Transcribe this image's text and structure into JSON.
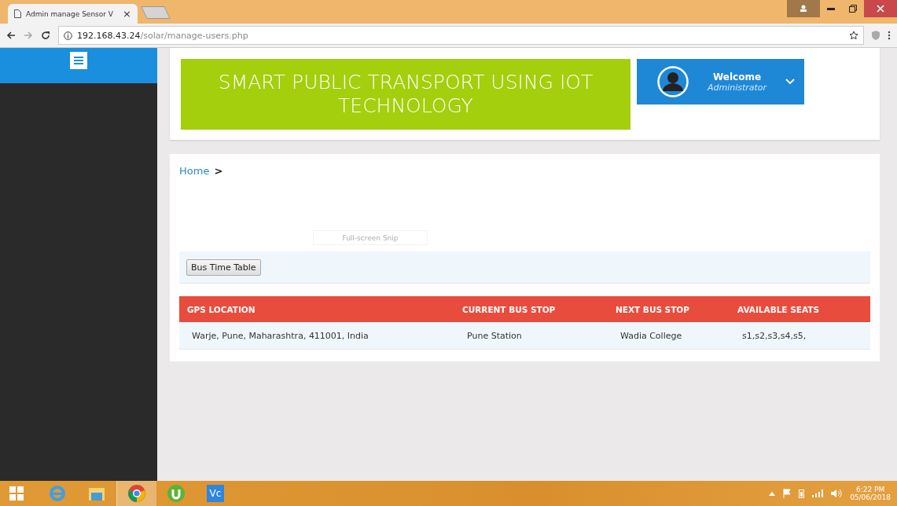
{
  "browser": {
    "tab_title": "Admin manage Sensor V",
    "tab_close": "×",
    "url_host": "192.168.43.24",
    "url_path": "/solar/manage-users.php"
  },
  "header": {
    "banner": "SMART PUBLIC TRANSPORT USING IOT TECHNOLOGY",
    "welcome": "Welcome",
    "role": "Administrator"
  },
  "breadcrumb": {
    "link": "Home",
    "separator": ">"
  },
  "snip_tooltip": "Full-screen Snip",
  "timetable_button": "Bus Time Table",
  "table": {
    "columns": [
      "GPS LOCATION",
      "CURRENT BUS STOP",
      "NEXT BUS STOP",
      "AVAILABLE SEATS"
    ],
    "rows": [
      [
        "Warje, Pune, Maharashtra, 411001, India",
        "Pune Station",
        "Wadia College",
        "s1,s2,s3,s4,s5,"
      ]
    ]
  },
  "taskbar": {
    "apps": [
      {
        "kind": "ie",
        "selected": false
      },
      {
        "kind": "explorer",
        "selected": false
      },
      {
        "kind": "chrome",
        "selected": true
      },
      {
        "kind": "torrent",
        "selected": false
      },
      {
        "kind": "vc",
        "selected": false
      }
    ],
    "vc_label": "Vc",
    "time": "6:22 PM",
    "date": "05/06/2018"
  }
}
